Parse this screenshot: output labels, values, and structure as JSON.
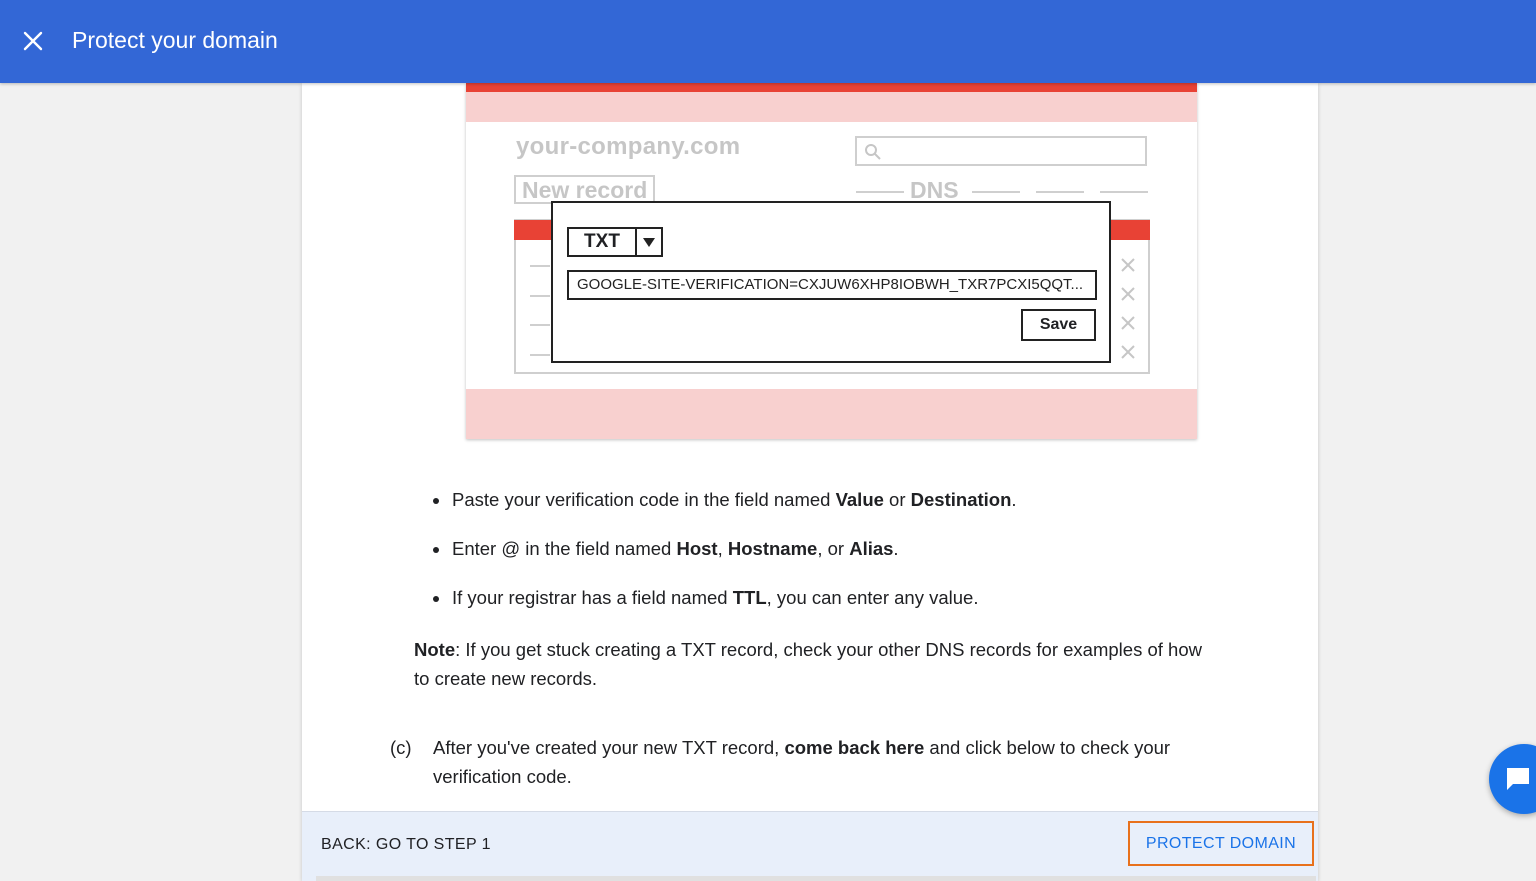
{
  "header": {
    "title": "Protect your domain",
    "close_icon": "close-icon"
  },
  "illustration": {
    "site_name": "your-company.com",
    "new_record_label": "New record",
    "dns_label": "DNS",
    "record_type": "TXT",
    "verification_value": "GOOGLE-SITE-VERIFICATION=CXJUW6XHP8IOBWH_TXR7PCXI5QQT...",
    "save_label": "Save",
    "colors": {
      "red": "#e84235",
      "pink": "#f8d0cf",
      "gray": "#c6c6c6"
    }
  },
  "instructions": {
    "bullets": [
      {
        "parts": [
          "Paste your verification code in the field named ",
          "Value",
          " or ",
          "Destination",
          "."
        ]
      },
      {
        "parts": [
          "Enter @ in the field named ",
          "Host",
          ", ",
          "Hostname",
          ", or ",
          "Alias",
          "."
        ]
      },
      {
        "parts": [
          "If your registrar has a field named ",
          "TTL",
          ", you can enter any value."
        ]
      }
    ],
    "note": {
      "label": "Note",
      "text": ": If you get stuck creating a TXT record, check your other DNS records for examples of how to create new records."
    },
    "step_c": {
      "label": "(c)",
      "text_before": "After you've created your new TXT record, ",
      "bold": "come back here",
      "text_after": " and click below to check your verification code."
    }
  },
  "footer": {
    "back_label": "BACK: GO TO STEP 1",
    "protect_label": "PROTECT DOMAIN",
    "accent": "#1a73e8",
    "focus_outline": "#e8711c"
  },
  "chat": {
    "icon": "chat-icon"
  }
}
